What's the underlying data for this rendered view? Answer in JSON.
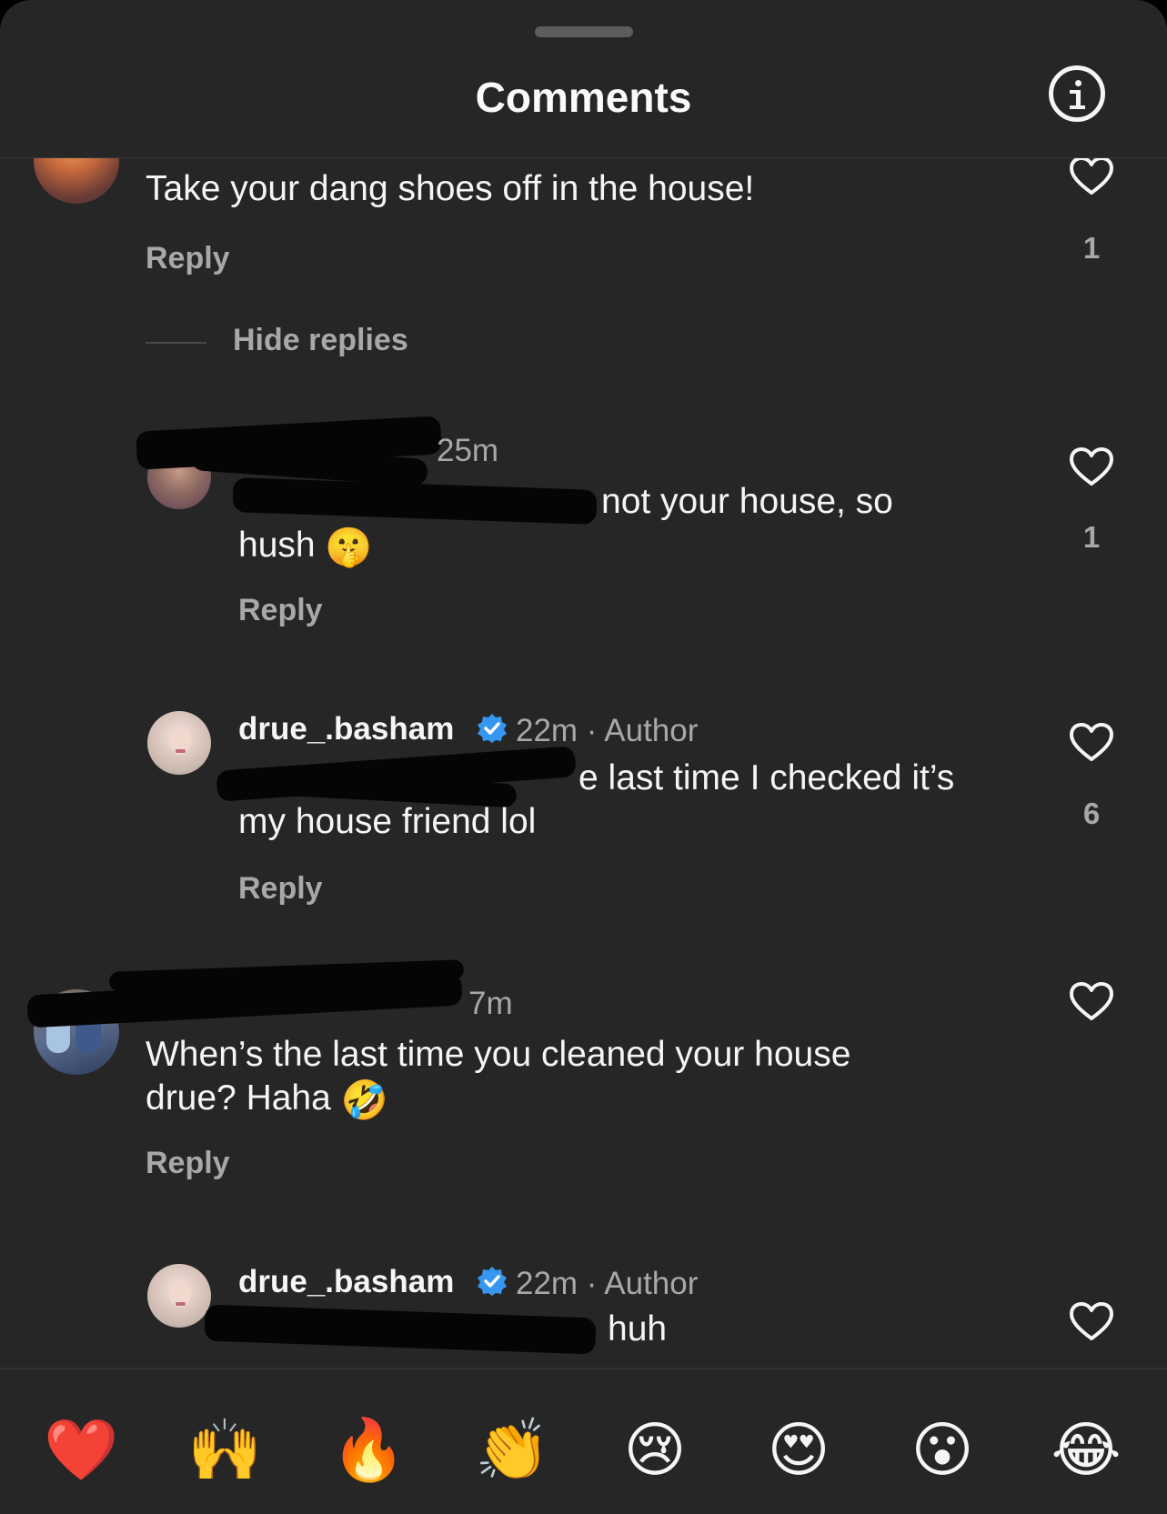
{
  "header": {
    "title": "Comments",
    "info_icon": "info-icon"
  },
  "comments": [
    {
      "text": "Take your dang shoes off in the house!",
      "reply": "Reply",
      "likes": "1"
    },
    {
      "time": "25m",
      "text_line1": "not your house, so",
      "text_line2": "hush",
      "emoji": "🤫",
      "reply": "Reply",
      "likes": "1"
    },
    {
      "username": "drue_.basham",
      "meta": "22m · Author",
      "text_line1": "e last time I checked it’s",
      "text_line2": "my house friend lol",
      "reply": "Reply",
      "likes": "6"
    },
    {
      "time": "7m",
      "text_line1": "When’s the last time you cleaned your house",
      "text_line2": "drue? Haha",
      "emoji": "🤣",
      "reply": "Reply"
    },
    {
      "username": "drue_.basham",
      "meta": "22m · Author",
      "text": "huh"
    }
  ],
  "thread": {
    "hide_replies": "Hide replies"
  },
  "reactions": [
    "❤️",
    "🙌",
    "🔥",
    "👏",
    "😢",
    "😍",
    "😮",
    "😂"
  ],
  "colors": {
    "background": "#262626",
    "text": "#f5f5f5",
    "secondary": "#a8a8a8",
    "verified": "#3797f0"
  }
}
